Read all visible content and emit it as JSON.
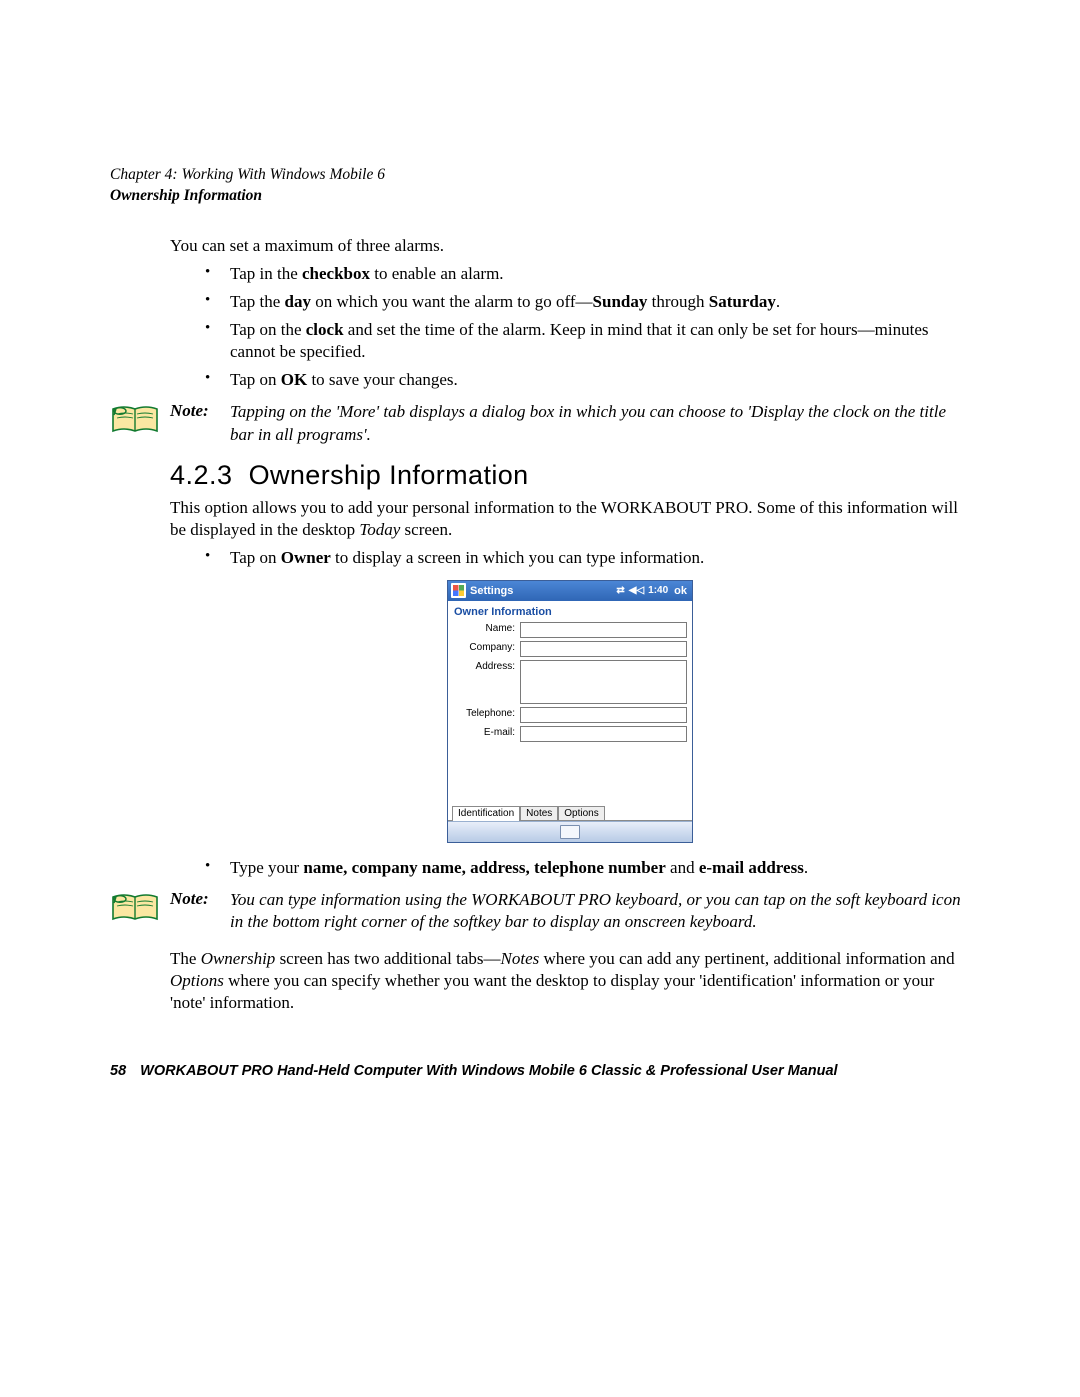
{
  "header": {
    "chapter_line": "Chapter  4:  Working With Windows Mobile 6",
    "section_line": "Ownership Information"
  },
  "intro_para": "You can set a maximum of three alarms.",
  "bullets1": {
    "b1_pre": "Tap in the ",
    "b1_bold": "checkbox",
    "b1_post": " to enable an alarm.",
    "b2_pre": "Tap the ",
    "b2_bold1": "day",
    "b2_mid": " on which you want the alarm to go off—",
    "b2_bold2": "Sunday",
    "b2_mid2": " through ",
    "b2_bold3": "Saturday",
    "b2_post": ".",
    "b3_pre": "Tap on the ",
    "b3_bold": "clock",
    "b3_post": " and set the time of the alarm. Keep in mind that it can only be set for hours—minutes cannot be specified.",
    "b4_pre": "Tap on ",
    "b4_bold": "OK",
    "b4_post": " to save your changes."
  },
  "note1": {
    "label": "Note:",
    "text": "Tapping on the 'More' tab displays a dialog box in which you can choose to 'Display the clock on the title bar in all programs'."
  },
  "section": {
    "number": "4.2.3",
    "title": "Ownership Information"
  },
  "para2_a": "This option allows you to add your personal information to the WORKABOUT PRO. Some of this information will be displayed in the desktop ",
  "para2_ital": "Today",
  "para2_b": " screen.",
  "bullet_owner_pre": "Tap on ",
  "bullet_owner_bold": "Owner",
  "bullet_owner_post": " to display a screen in which you can type information.",
  "device": {
    "titlebar": "Settings",
    "time": "1:40",
    "ok": "ok",
    "heading": "Owner Information",
    "labels": {
      "name": "Name:",
      "company": "Company:",
      "address": "Address:",
      "telephone": "Telephone:",
      "email": "E-mail:"
    },
    "tabs": {
      "identification": "Identification",
      "notes": "Notes",
      "options": "Options"
    }
  },
  "bullet_type_pre": "Type your ",
  "bullet_type_bold1": "name, company name, address, telephone number",
  "bullet_type_mid": " and ",
  "bullet_type_bold2": "e-mail address",
  "bullet_type_post": ".",
  "note2": {
    "label": "Note:",
    "text": "You can type information using the WORKABOUT PRO keyboard, or you can tap on the soft keyboard icon in the bottom right corner of the softkey bar to display an onscreen keyboard."
  },
  "para3_a": "The ",
  "para3_i1": "Ownership",
  "para3_b": " screen has two additional tabs—",
  "para3_i2": "Notes",
  "para3_c": " where you can add any pertinent, additional information and ",
  "para3_i3": "Options",
  "para3_d": " where you can specify whether you want the desktop to display your 'identification' information or your 'note' information.",
  "footer": {
    "page": "58",
    "title": "WORKABOUT PRO Hand-Held Computer With Windows Mobile 6 Classic & Professional User Manual"
  }
}
